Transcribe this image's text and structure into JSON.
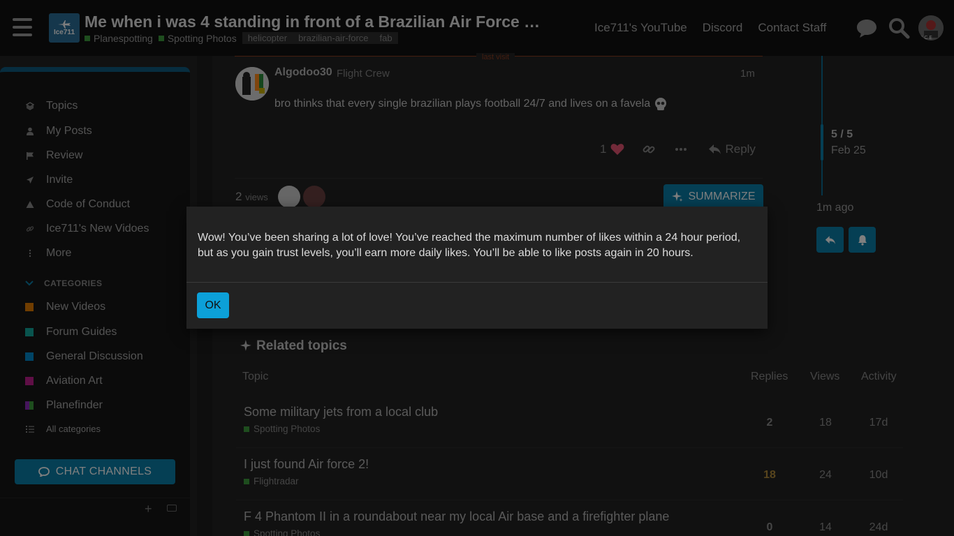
{
  "header": {
    "logo_text": "Ice711",
    "title": "Me when i was 4 standing in front of a Brazilian Air Force …",
    "categories": [
      "Planespotting",
      "Spotting Photos"
    ],
    "tags": [
      "helicopter",
      "brazilian-air-force",
      "fab"
    ],
    "links": [
      "Ice711's YouTube",
      "Discord",
      "Contact Staff"
    ]
  },
  "sidebar": {
    "items": [
      {
        "label": "Topics",
        "icon": "layers-icon"
      },
      {
        "label": "My Posts",
        "icon": "user-icon"
      },
      {
        "label": "Review",
        "icon": "flag-icon"
      },
      {
        "label": "Invite",
        "icon": "paper-plane-icon"
      },
      {
        "label": "Code of Conduct",
        "icon": "warning-icon"
      },
      {
        "label": "Ice711's New Vidoes",
        "icon": "link-icon"
      },
      {
        "label": "More",
        "icon": "vertical-ellipsis-icon"
      }
    ],
    "categories_heading": "CATEGORIES",
    "categories": [
      {
        "label": "New Videos",
        "color": "#e07b00"
      },
      {
        "label": "Forum Guides",
        "color": "#12a89d"
      },
      {
        "label": "General Discussion",
        "color": "#0088cc"
      },
      {
        "label": "Aviation Art",
        "color": "#bf1e8c"
      },
      {
        "label": "Planefinder",
        "color": "#8a2bb8"
      }
    ],
    "all_categories": "All categories",
    "chat_channels": "CHAT CHANNELS"
  },
  "post": {
    "last_visit": "last visit",
    "author": "Algodoo30",
    "author_title": "Flight Crew",
    "time": "1m",
    "body": "bro thinks that every single brazilian plays football 24/7 and lives on a favela",
    "like_count": "1",
    "reply_label": "Reply",
    "views_count": "2",
    "views_label": "views",
    "summarize_label": "SUMMARIZE"
  },
  "timeline": {
    "position": "5 / 5",
    "date": "Feb 25",
    "ago": "1m ago"
  },
  "related": {
    "title": "Related topics",
    "columns": [
      "Topic",
      "Replies",
      "Views",
      "Activity"
    ],
    "rows": [
      {
        "title": "Some military jets from a local club",
        "category": "Spotting Photos",
        "cat_color": "#3c9b3c",
        "replies": "2",
        "views": "18",
        "activity": "17d"
      },
      {
        "title": "I just found Air force 2!",
        "category": "Flightradar",
        "cat_color": "#3c9b3c",
        "replies": "18",
        "views": "24",
        "activity": "10d"
      },
      {
        "title": "F 4 Phantom II in a roundabout near my local Air base and a firefighter plane",
        "category": "Spotting Photos",
        "cat_color": "#3c9b3c",
        "replies": "0",
        "views": "14",
        "activity": "24d"
      }
    ]
  },
  "modal": {
    "message": "Wow! You’ve been sharing a lot of love! You’ve reached the maximum number of likes within a 24 hour period, but as you gain trust levels, you’ll earn more daily likes. You’ll be able to like posts again in 20 hours.",
    "ok_label": "OK"
  },
  "colors": {
    "accent": "#0a7fa8",
    "ok_button": "#0ca0d8",
    "like_heart": "#e45573",
    "last_visit": "#8a3d21"
  }
}
